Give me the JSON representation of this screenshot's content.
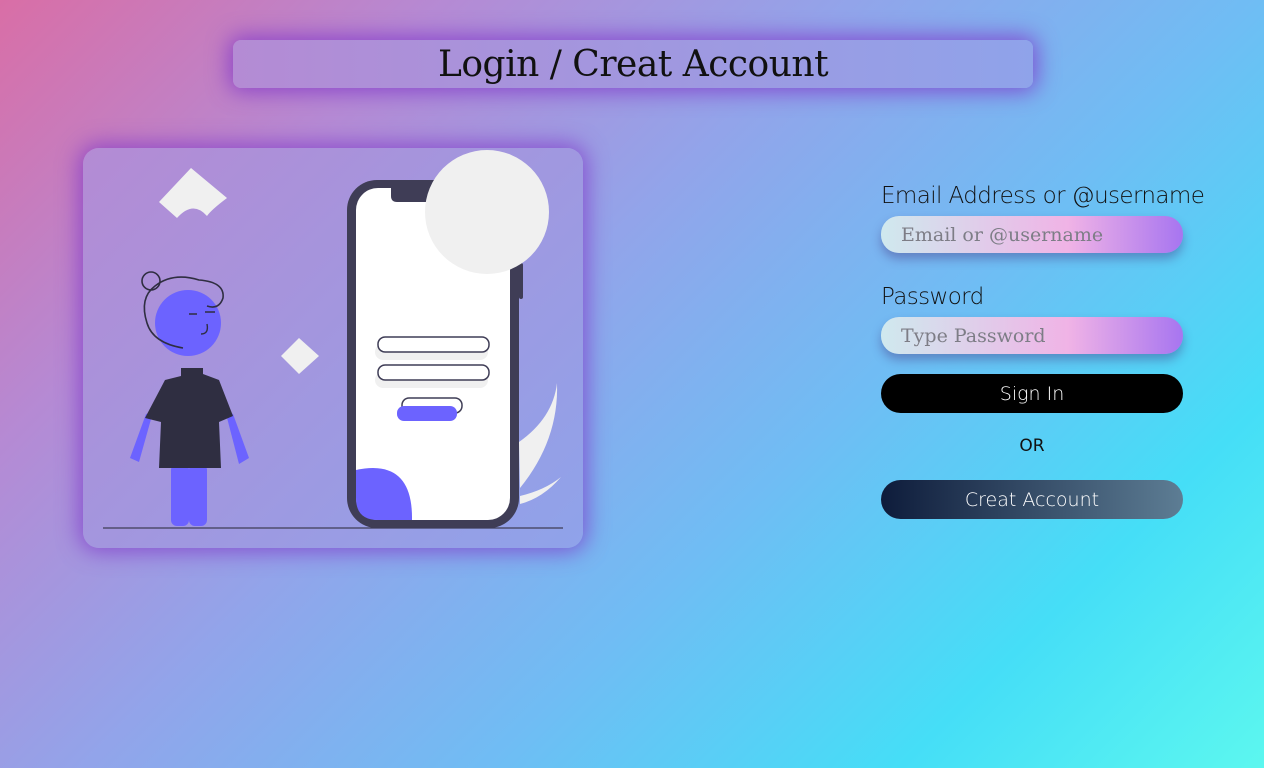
{
  "header": {
    "title": "Login / Creat Account"
  },
  "illustration": {
    "icon": "person-with-phone-login-illustration",
    "accent_color": "#6c63ff",
    "dark_color": "#2f2e41"
  },
  "form": {
    "email_label": "Email Address or @username",
    "email_placeholder": "Email or @username",
    "email_value": "",
    "password_label": "Password",
    "password_placeholder": "Type Password",
    "password_value": "",
    "signin_label": "Sign In",
    "or_text": "OR",
    "create_label": "Creat Account"
  },
  "colors": {
    "signin_button": "#000000",
    "create_button_start": "#0e1c3b",
    "create_button_end": "#5d7d94"
  }
}
